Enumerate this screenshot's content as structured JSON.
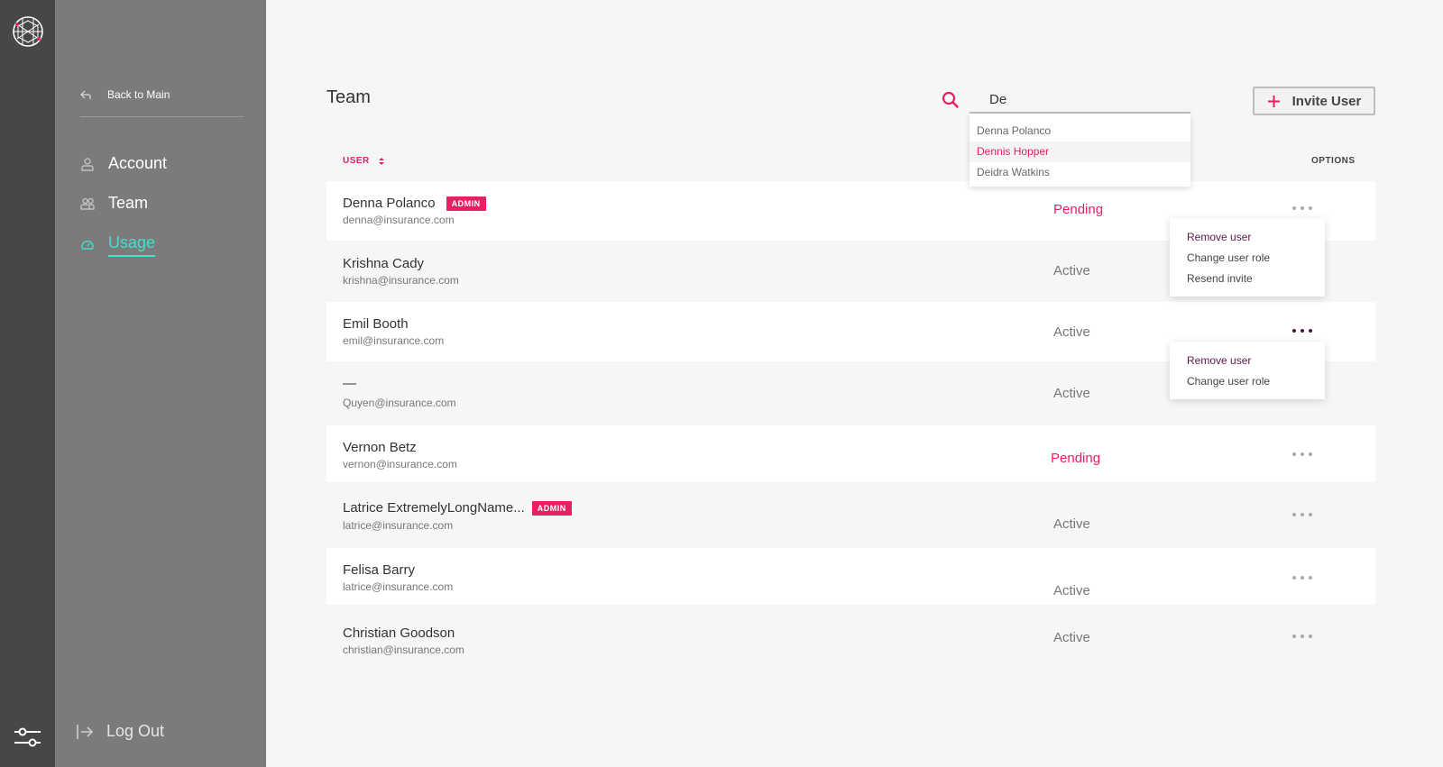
{
  "sidebar": {
    "back_label": "Back to Main",
    "items": [
      {
        "label": "Account",
        "icon": "user-icon"
      },
      {
        "label": "Team",
        "icon": "team-icon"
      },
      {
        "label": "Usage",
        "icon": "gauge-icon",
        "active": true
      }
    ],
    "logout_label": "Log Out"
  },
  "page": {
    "title": "Team",
    "search": {
      "value": "De"
    },
    "suggestions": [
      "Denna Polanco",
      "Dennis Hopper",
      "Deidra Watkins"
    ],
    "invite_label": "Invite User"
  },
  "table": {
    "col_user": "USER",
    "col_options": "OPTIONS",
    "admin_badge": "ADMIN",
    "rows": [
      {
        "name": "Denna Polanco",
        "email": "denna@insurance.com",
        "status": "Pending",
        "admin": true
      },
      {
        "name": "Krishna Cady",
        "email": "krishna@insurance.com",
        "status": "Active"
      },
      {
        "name": "Emil Booth",
        "email": "emil@insurance.com",
        "status": "Active"
      },
      {
        "name": "—",
        "email": "Quyen@insurance.com",
        "status": "Active"
      },
      {
        "name": "Vernon Betz",
        "email": "vernon@insurance.com",
        "status": "Pending"
      },
      {
        "name": "Latrice ExtremelyLongName...",
        "email": "latrice@insurance.com",
        "status": "Active",
        "admin": true
      },
      {
        "name": "Felisa Barry",
        "email": "latrice@insurance.com",
        "status": "Active"
      },
      {
        "name": "Christian Goodson",
        "email": "christian@insurance.com",
        "status": "Active"
      }
    ]
  },
  "menus": {
    "row1": [
      "Remove user",
      "Change user role",
      "Resend invite"
    ],
    "row3": [
      "Remove user",
      "Change user role"
    ]
  },
  "colors": {
    "accent": "#e91e63",
    "nav_active": "#3fe0cf",
    "rail": "#474747",
    "sidebar": "#7b7b7b"
  }
}
